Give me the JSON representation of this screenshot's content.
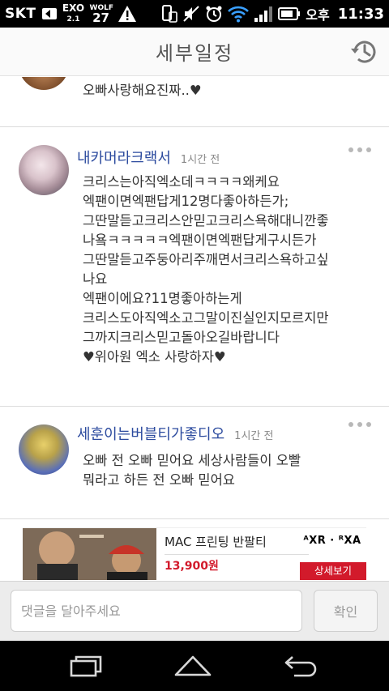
{
  "status_bar": {
    "carrier": "SKT",
    "exo_icon_text": "EXO",
    "exo_sub": "2.1",
    "wolf_label": "WOLF",
    "wolf_number": "27",
    "ampm": "오후",
    "time": "11:33"
  },
  "header": {
    "title": "세부일정",
    "history_icon": "history-clock-icon"
  },
  "comments": [
    {
      "author": "",
      "time": "",
      "body": "오빠사랑해요진짜..♥"
    },
    {
      "author": "내카머라크랙서",
      "time": "1시간 전",
      "body": "크리스는아직엑소데ㅋㅋㅋㅋ왜케요\n엑팬이면엑팬답게12명다좋아하든가;\n그딴말듣고크리스안믿고크리스욕해대니깐좋\n나욬ㅋㅋㅋㅋㅋ엑팬이면엑팬답게구시든가\n그딴말듣고주둥아리주깨면서크리스욕하고싶\n나요\n엑팬이에요?11명좋아하는게\n크리스도아직엑소고그말이진실인지모르지만\n그까지크리스믿고돌아오길바랍니다\n♥위아원  엑소  사랑하자♥"
    },
    {
      "author": "세훈이는버블티가좋디오",
      "time": "1시간 전",
      "body": "오빠 전 오빠 믿어요 세상사람들이 오빨\n뭐라고 하든 전 오빠 믿어요"
    }
  ],
  "ad": {
    "product": "MAC 프린팅 반팔티",
    "price": "13,900원",
    "brand": "ᴬXR · ᴿXA",
    "cta": "상세보기"
  },
  "input": {
    "placeholder": "댓글을 달아주세요",
    "value": "",
    "confirm_label": "확인"
  },
  "navbar": {
    "icons": [
      "recent-apps-icon",
      "home-icon",
      "back-icon"
    ]
  },
  "colors": {
    "author": "#2b4a9e",
    "ad_accent": "#d21a2b"
  }
}
